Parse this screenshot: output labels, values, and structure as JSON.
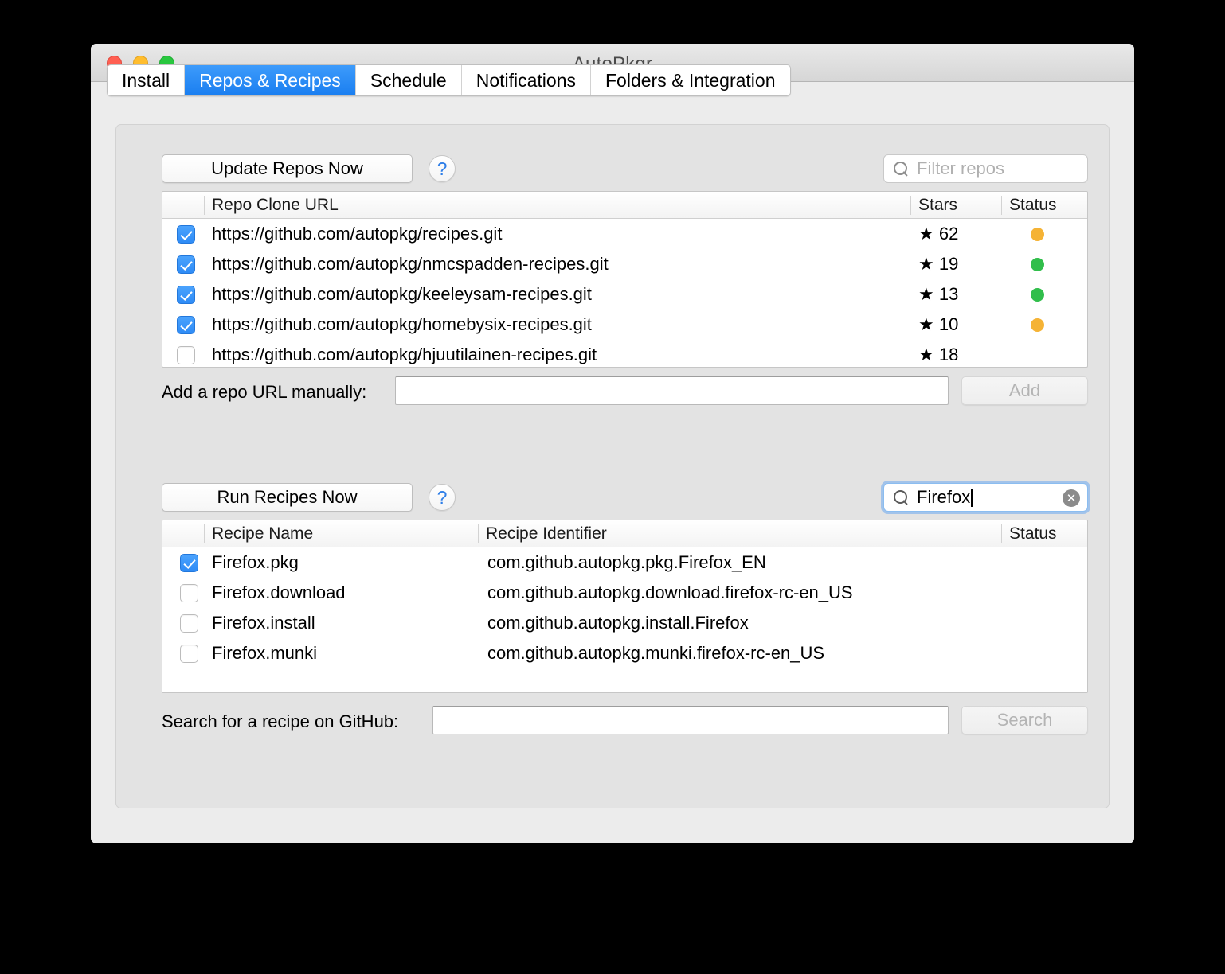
{
  "window": {
    "title": "AutoPkgr",
    "traffic_lights": [
      "close-button",
      "minimize-button",
      "zoom-button"
    ]
  },
  "tabs": [
    {
      "label": "Install",
      "active": false
    },
    {
      "label": "Repos & Recipes",
      "active": true
    },
    {
      "label": "Schedule",
      "active": false
    },
    {
      "label": "Notifications",
      "active": false
    },
    {
      "label": "Folders & Integration",
      "active": false
    }
  ],
  "repos_section": {
    "update_button": "Update Repos Now",
    "help_glyph": "?",
    "filter": {
      "placeholder": "Filter repos",
      "value": ""
    },
    "columns": [
      "Repo Clone URL",
      "Stars",
      "Status"
    ],
    "rows": [
      {
        "checked": true,
        "url": "https://github.com/autopkg/recipes.git",
        "stars": "★ 62",
        "status_color": "#f5b335"
      },
      {
        "checked": true,
        "url": "https://github.com/autopkg/nmcspadden-recipes.git",
        "stars": "★ 19",
        "status_color": "#31be4b"
      },
      {
        "checked": true,
        "url": "https://github.com/autopkg/keeleysam-recipes.git",
        "stars": "★ 13",
        "status_color": "#31be4b"
      },
      {
        "checked": true,
        "url": "https://github.com/autopkg/homebysix-recipes.git",
        "stars": "★ 10",
        "status_color": "#f5b335"
      },
      {
        "checked": false,
        "url": "https://github.com/autopkg/hjuutilainen-recipes.git",
        "stars": "★ 18",
        "status_color": ""
      }
    ],
    "add_label": "Add a repo URL manually:",
    "add_value": "",
    "add_button": "Add"
  },
  "recipes_section": {
    "run_button": "Run Recipes Now",
    "help_glyph": "?",
    "search": {
      "value": "Firefox",
      "clear_glyph": "✕"
    },
    "columns": [
      "Recipe Name",
      "Recipe Identifier",
      "Status"
    ],
    "rows": [
      {
        "checked": true,
        "name": "Firefox.pkg",
        "identifier": "com.github.autopkg.pkg.Firefox_EN"
      },
      {
        "checked": false,
        "name": "Firefox.download",
        "identifier": "com.github.autopkg.download.firefox-rc-en_US"
      },
      {
        "checked": false,
        "name": "Firefox.install",
        "identifier": "com.github.autopkg.install.Firefox"
      },
      {
        "checked": false,
        "name": "Firefox.munki",
        "identifier": "com.github.autopkg.munki.firefox-rc-en_US"
      }
    ],
    "github_label": "Search for a recipe on GitHub:",
    "github_value": "",
    "search_button": "Search"
  },
  "colors": {
    "accent": "#2e8bf6",
    "status_warning": "#f5b335",
    "status_ok": "#31be4b",
    "window_bg": "#ececec",
    "panel_bg": "#e3e3e3"
  }
}
